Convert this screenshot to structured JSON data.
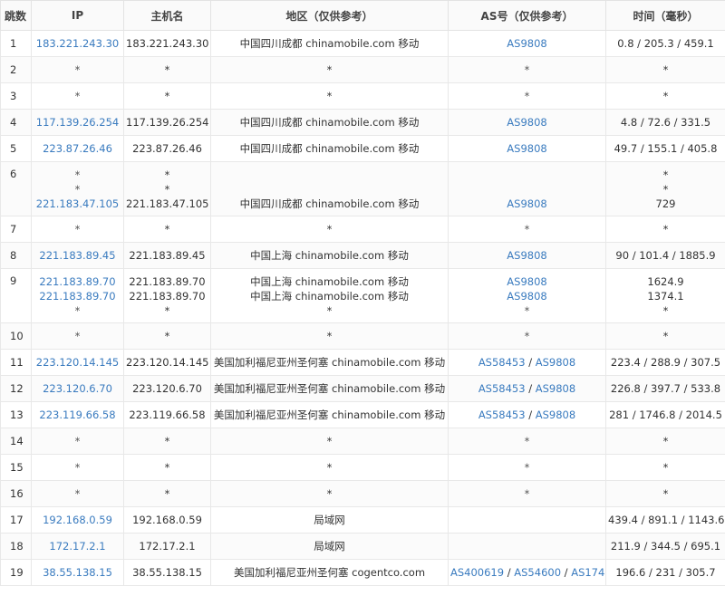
{
  "headers": {
    "hop": "跳数",
    "ip": "IP",
    "host": "主机名",
    "region": "地区（仅供参考）",
    "as": "AS号（仅供参考）",
    "time": "时间（毫秒）"
  },
  "colors": {
    "link": "#3a7bbf",
    "border": "#e8e8e8"
  },
  "rows": [
    {
      "hop": "1",
      "ip": "183.221.243.30",
      "host": "183.221.243.30",
      "region": "中国四川成都 chinamobile.com 移动",
      "as": [
        "AS9808"
      ],
      "time": "0.8 / 205.3 / 459.1"
    },
    {
      "hop": "2",
      "ip": "*",
      "host": "*",
      "region": "*",
      "as": [
        "*"
      ],
      "time": "*"
    },
    {
      "hop": "3",
      "ip": "*",
      "host": "*",
      "region": "*",
      "as": [
        "*"
      ],
      "time": "*"
    },
    {
      "hop": "4",
      "ip": "117.139.26.254",
      "host": "117.139.26.254",
      "region": "中国四川成都 chinamobile.com 移动",
      "as": [
        "AS9808"
      ],
      "time": "4.8 / 72.6 / 331.5"
    },
    {
      "hop": "5",
      "ip": "223.87.26.46",
      "host": "223.87.26.46",
      "region": "中国四川成都 chinamobile.com 移动",
      "as": [
        "AS9808"
      ],
      "time": "49.7 / 155.1 / 405.8"
    },
    {
      "hop": "6",
      "multi": [
        {
          "ip": "*",
          "host": "*",
          "region": "",
          "as": [
            ""
          ],
          "time": "*"
        },
        {
          "ip": "*",
          "host": "*",
          "region": "",
          "as": [
            ""
          ],
          "time": "*"
        },
        {
          "ip": "221.183.47.105",
          "host": "221.183.47.105",
          "region": "中国四川成都 chinamobile.com 移动",
          "as": [
            "AS9808"
          ],
          "time": "729"
        }
      ]
    },
    {
      "hop": "7",
      "ip": "*",
      "host": "*",
      "region": "*",
      "as": [
        "*"
      ],
      "time": "*"
    },
    {
      "hop": "8",
      "ip": "221.183.89.45",
      "host": "221.183.89.45",
      "region": "中国上海 chinamobile.com 移动",
      "as": [
        "AS9808"
      ],
      "time": "90 / 101.4 / 1885.9"
    },
    {
      "hop": "9",
      "multi": [
        {
          "ip": "221.183.89.70",
          "host": "221.183.89.70",
          "region": "中国上海 chinamobile.com 移动",
          "as": [
            "AS9808"
          ],
          "time": "1624.9"
        },
        {
          "ip": "221.183.89.70",
          "host": "221.183.89.70",
          "region": "中国上海 chinamobile.com 移动",
          "as": [
            "AS9808"
          ],
          "time": "1374.1"
        },
        {
          "ip": "*",
          "host": "*",
          "region": "*",
          "as": [
            "*"
          ],
          "time": "*"
        }
      ]
    },
    {
      "hop": "10",
      "ip": "*",
      "host": "*",
      "region": "*",
      "as": [
        "*"
      ],
      "time": "*"
    },
    {
      "hop": "11",
      "ip": "223.120.14.145",
      "host": "223.120.14.145",
      "region": "美国加利福尼亚州圣何塞 chinamobile.com 移动",
      "as": [
        "AS58453",
        "AS9808"
      ],
      "time": "223.4 / 288.9 / 307.5"
    },
    {
      "hop": "12",
      "ip": "223.120.6.70",
      "host": "223.120.6.70",
      "region": "美国加利福尼亚州圣何塞 chinamobile.com 移动",
      "as": [
        "AS58453",
        "AS9808"
      ],
      "time": "226.8 / 397.7 / 533.8"
    },
    {
      "hop": "13",
      "ip": "223.119.66.58",
      "host": "223.119.66.58",
      "region": "美国加利福尼亚州圣何塞 chinamobile.com 移动",
      "as": [
        "AS58453",
        "AS9808"
      ],
      "time": "281 / 1746.8 / 2014.5"
    },
    {
      "hop": "14",
      "ip": "*",
      "host": "*",
      "region": "*",
      "as": [
        "*"
      ],
      "time": "*"
    },
    {
      "hop": "15",
      "ip": "*",
      "host": "*",
      "region": "*",
      "as": [
        "*"
      ],
      "time": "*"
    },
    {
      "hop": "16",
      "ip": "*",
      "host": "*",
      "region": "*",
      "as": [
        "*"
      ],
      "time": "*"
    },
    {
      "hop": "17",
      "ip": "192.168.0.59",
      "host": "192.168.0.59",
      "region": "局域网",
      "as": [],
      "time": "439.4 / 891.1 / 1143.6"
    },
    {
      "hop": "18",
      "ip": "172.17.2.1",
      "host": "172.17.2.1",
      "region": "局域网",
      "as": [],
      "time": "211.9 / 344.5 / 695.1"
    },
    {
      "hop": "19",
      "ip": "38.55.138.15",
      "host": "38.55.138.15",
      "region": "美国加利福尼亚州圣何塞 cogentco.com",
      "as": [
        "AS400619",
        "AS54600",
        "AS174"
      ],
      "time": "196.6 / 231 / 305.7"
    }
  ]
}
